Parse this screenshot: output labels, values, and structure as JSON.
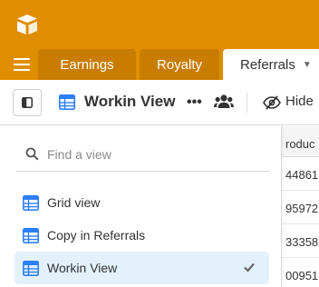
{
  "tabs": [
    {
      "label": "Earnings",
      "active": false
    },
    {
      "label": "Royalty",
      "active": false
    },
    {
      "label": "Referrals",
      "active": true
    }
  ],
  "toolbar": {
    "view_name": "Workin View",
    "more_label": "•••",
    "hide_label": "Hide"
  },
  "view_switcher": {
    "search_placeholder": "Find a view",
    "items": [
      {
        "label": "Grid view",
        "selected": false
      },
      {
        "label": "Copy in Referrals",
        "selected": false
      },
      {
        "label": "Workin View",
        "selected": true
      }
    ]
  },
  "grid": {
    "column_header": "roduc",
    "cells": [
      "44861",
      "95972",
      "33358",
      "00951"
    ]
  },
  "colors": {
    "header_orange": "#e08d00",
    "tab_inactive": "#c97d00",
    "grid_icon_blue": "#2d7ff9",
    "selected_row_bg": "#e3f1fb"
  }
}
